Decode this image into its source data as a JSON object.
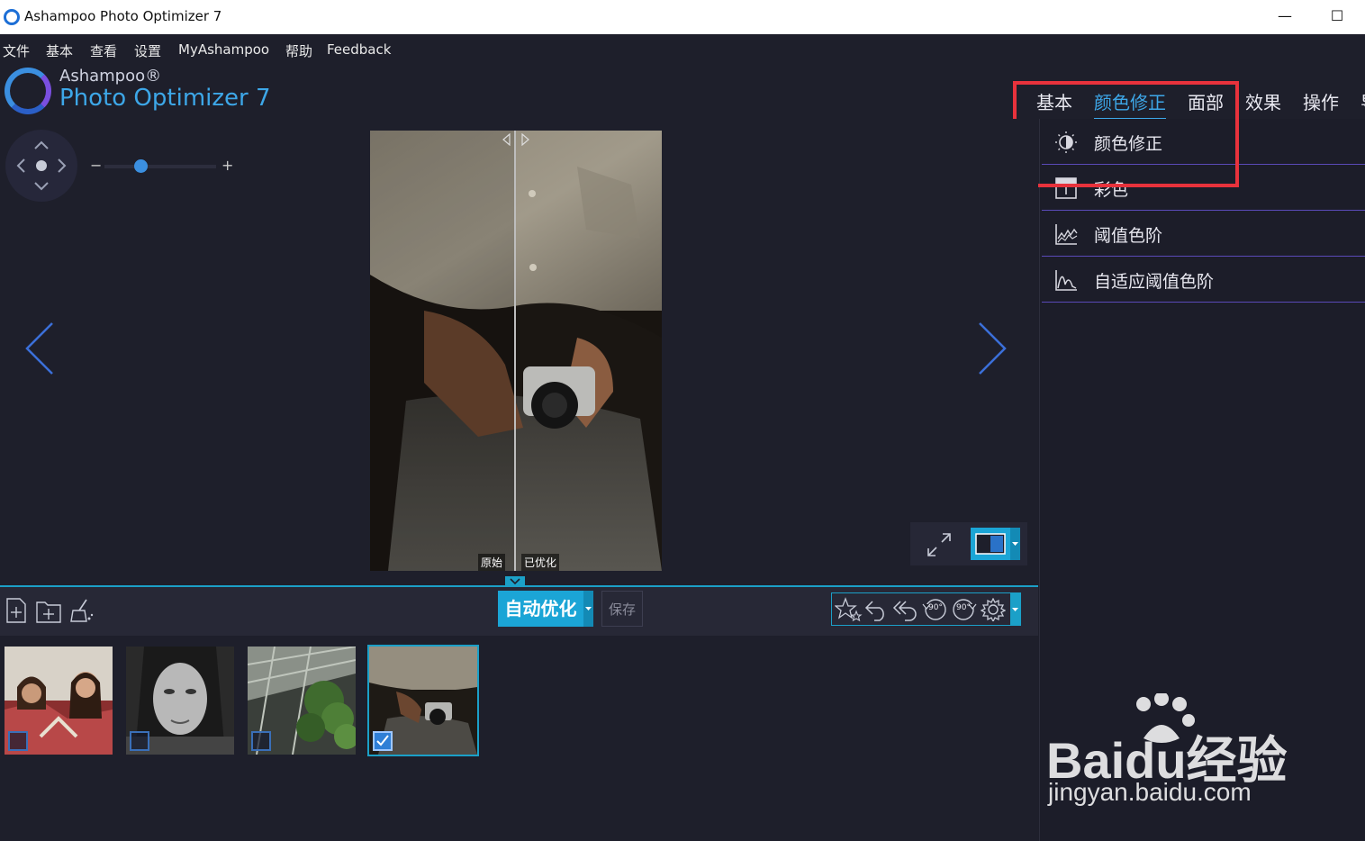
{
  "window": {
    "title": "Ashampoo Photo Optimizer 7",
    "minimize": "—",
    "maximize": "☐"
  },
  "menu": [
    "文件",
    "基本",
    "查看",
    "设置",
    "MyAshampoo",
    "帮助",
    "Feedback"
  ],
  "logo": {
    "brand": "Ashampoo®",
    "product": "Photo Optimizer 7"
  },
  "category_tabs": [
    {
      "label": "基本",
      "active": false
    },
    {
      "label": "颜色修正",
      "active": true
    },
    {
      "label": "面部",
      "active": false
    },
    {
      "label": "效果",
      "active": false
    },
    {
      "label": "操作",
      "active": false
    },
    {
      "label": "导",
      "active": false
    }
  ],
  "panel_items": [
    {
      "label": "颜色修正",
      "icon": "brightness-contrast-icon"
    },
    {
      "label": "彩色",
      "icon": "color-icon"
    },
    {
      "label": "阈值色阶",
      "icon": "threshold-levels-icon"
    },
    {
      "label": "自适应阈值色阶",
      "icon": "adaptive-levels-icon"
    }
  ],
  "zoom": {
    "minus": "−",
    "plus": "+",
    "level": 0.3
  },
  "compare_labels": {
    "original": "原始",
    "optimized": "已优化"
  },
  "toolbar": {
    "auto_optimize": "自动优化",
    "save": "保存",
    "rotate_left": "90°",
    "rotate_right": "90°"
  },
  "thumbnails": [
    {
      "name": "two-women-photo",
      "checked": false
    },
    {
      "name": "bw-woman-portrait",
      "checked": false
    },
    {
      "name": "greenhouse-plants",
      "checked": false
    },
    {
      "name": "camera-person",
      "checked": true
    }
  ],
  "watermark": {
    "brand": "Baidu经验",
    "url": "jingyan.baidu.com"
  },
  "colors": {
    "accent": "#1ba5d6",
    "tab_active": "#3da7e8",
    "highlight": "#e8323c",
    "background": "#1e1f2b"
  }
}
